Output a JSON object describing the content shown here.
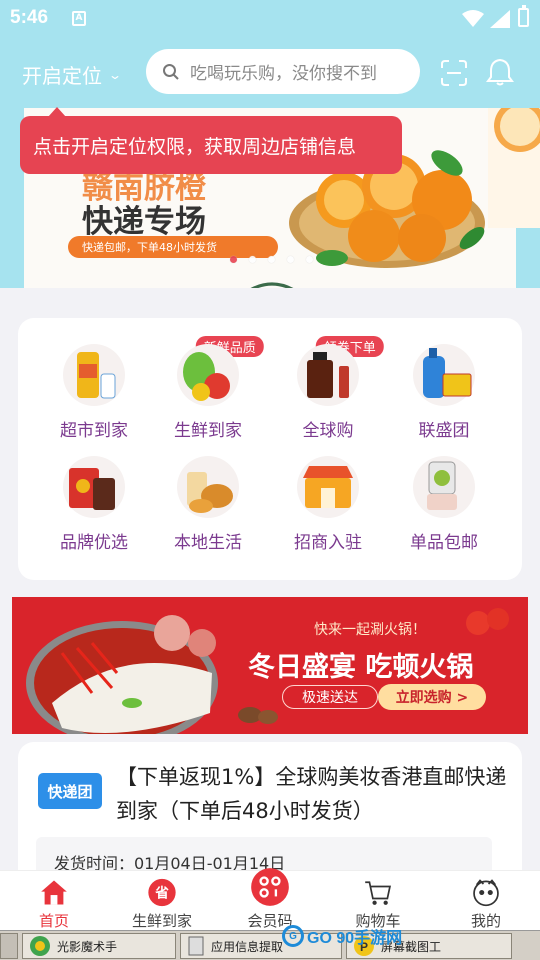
{
  "status_bar": {
    "time": "5:46",
    "notification_icon": "A"
  },
  "header": {
    "location_label": "开启定位",
    "search_placeholder": "吃喝玩乐购，没你搜不到"
  },
  "tooltip": {
    "text": "点击开启定位权限，获取周边店铺信息"
  },
  "banner": {
    "title_line1": "赣南脐橙",
    "title_line2": "快递专场",
    "tagline": "快递包邮，下单48小时发货",
    "slide_count": 5,
    "active_slide": 1
  },
  "categories": [
    {
      "label": "超市到家",
      "icon": "oil-bottle-icon",
      "badge": ""
    },
    {
      "label": "生鲜到家",
      "icon": "vegetables-icon",
      "badge": "新鲜品质"
    },
    {
      "label": "全球购",
      "icon": "cosmetics-icon",
      "badge": "领券下单"
    },
    {
      "label": "联盛团",
      "icon": "detergent-icon",
      "badge": ""
    },
    {
      "label": "品牌优选",
      "icon": "snack-bag-icon",
      "badge": ""
    },
    {
      "label": "本地生活",
      "icon": "fried-chicken-icon",
      "badge": ""
    },
    {
      "label": "招商入驻",
      "icon": "storefront-icon",
      "badge": ""
    },
    {
      "label": "单品包邮",
      "icon": "blender-icon",
      "badge": ""
    }
  ],
  "promo": {
    "subtitle": "快来一起涮火锅！",
    "title": "冬日盛宴 吃顿火锅",
    "left_pill": "极速送达",
    "button_label": "立即选购 >"
  },
  "product": {
    "tag": "快递团",
    "title": "【下单返现1%】全球购美妆香港直邮快递到家（下单后48小时发货）",
    "ship_time": "发货时间：01月04日-01月14日"
  },
  "tabbar": [
    {
      "label": "首页",
      "icon": "home-icon",
      "active": true
    },
    {
      "label": "生鲜到家",
      "icon": "province-icon",
      "active": false
    },
    {
      "label": "会员码",
      "icon": "member-code-icon",
      "active": false
    },
    {
      "label": "购物车",
      "icon": "cart-icon",
      "active": false
    },
    {
      "label": "我的",
      "icon": "profile-icon",
      "active": false
    }
  ],
  "taskbar": {
    "items": [
      "光影魔术手",
      "应用信息提取",
      "屏幕截图工"
    ],
    "watermark": "GO 90手游网"
  },
  "colors": {
    "accent": "#e8343c",
    "header_bg": "#a6e3ef",
    "label_purple": "#7b3a8f"
  }
}
